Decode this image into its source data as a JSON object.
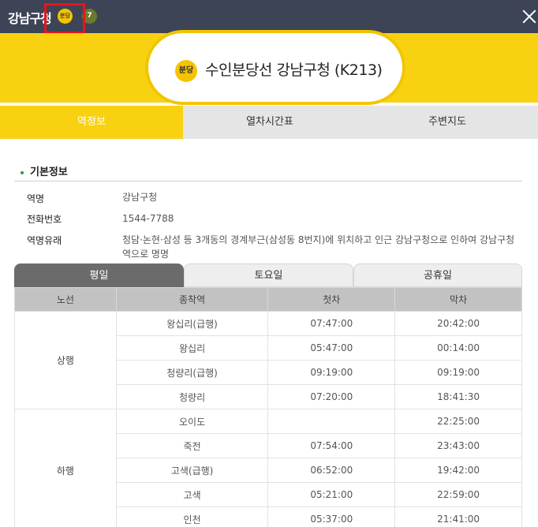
{
  "header": {
    "title": "강남구청",
    "line_badge": "분당",
    "transfer_badge": "7"
  },
  "banner": {
    "line_badge": "분당",
    "station_name": "수인분당선 강남구청 (K213)"
  },
  "main_tabs": [
    "역정보",
    "열차시간표",
    "주변지도"
  ],
  "basic_info": {
    "title": "기본정보",
    "rows": [
      {
        "label": "역명",
        "value": "강남구청"
      },
      {
        "label": "전화번호",
        "value": "1544-7788"
      },
      {
        "label": "역명유래",
        "value": "청담·논현·삼성 등 3개동의 경계부근(삼성동 8번지)에 위치하고 인근 강남구청으로 인하여 강남구청역으로 명명"
      }
    ]
  },
  "day_tabs": [
    "평일",
    "토요일",
    "공휴일"
  ],
  "timetable": {
    "headers": [
      "노선",
      "종착역",
      "첫차",
      "막차"
    ],
    "groups": [
      {
        "direction": "상행",
        "rows": [
          {
            "dest": "왕십리(급행)",
            "first": "07:47:00",
            "last": "20:42:00"
          },
          {
            "dest": "왕십리",
            "first": "05:47:00",
            "last": "00:14:00"
          },
          {
            "dest": "청량리(급행)",
            "first": "09:19:00",
            "last": "09:19:00"
          },
          {
            "dest": "청량리",
            "first": "07:20:00",
            "last": "18:41:30"
          }
        ]
      },
      {
        "direction": "하행",
        "rows": [
          {
            "dest": "오이도",
            "first": "",
            "last": "22:25:00"
          },
          {
            "dest": "죽전",
            "first": "07:54:00",
            "last": "23:43:00"
          },
          {
            "dest": "고색(급행)",
            "first": "06:52:00",
            "last": "19:42:00"
          },
          {
            "dest": "고색",
            "first": "05:21:00",
            "last": "22:59:00"
          },
          {
            "dest": "인천",
            "first": "05:37:00",
            "last": "21:41:00"
          }
        ]
      }
    ]
  },
  "colors": {
    "topbar": "#3d4455",
    "accent_yellow": "#f8d210",
    "highlight_red": "#e8141c",
    "line7_green": "#6b7a2c"
  },
  "icons": {
    "close": "close-icon"
  }
}
